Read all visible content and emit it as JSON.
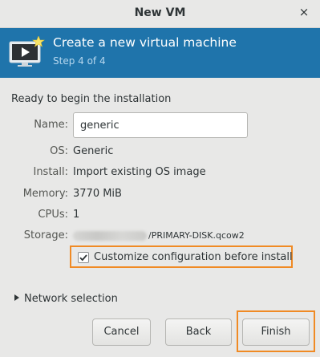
{
  "window": {
    "title": "New VM",
    "close_glyph": "×"
  },
  "header": {
    "heading": "Create a new virtual machine",
    "step": "Step 4 of 4",
    "icon": "vm-monitor-icon",
    "background_color": "#1f74ab"
  },
  "summary": {
    "ready_text": "Ready to begin the installation",
    "name_label": "Name:",
    "name_value": "generic",
    "os_label": "OS:",
    "os_value": "Generic",
    "install_label": "Install:",
    "install_value": "Import existing OS image",
    "memory_label": "Memory:",
    "memory_value": "3770 MiB",
    "cpus_label": "CPUs:",
    "cpus_value": "1",
    "storage_label": "Storage:",
    "storage_value_suffix": "/PRIMARY-DISK.qcow2"
  },
  "customize": {
    "label": "Customize configuration before install",
    "checked": true
  },
  "network": {
    "label": "Network selection",
    "expanded": false
  },
  "buttons": {
    "cancel": "Cancel",
    "back": "Back",
    "finish": "Finish"
  },
  "highlight_color": "#f08a24"
}
